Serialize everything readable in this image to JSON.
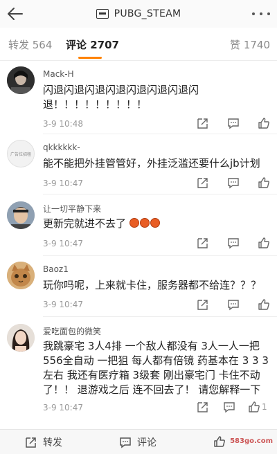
{
  "header": {
    "title": "PUBG_STEAM"
  },
  "tabs": {
    "repost": "转发 564",
    "comment": "评论 2707",
    "like": "赞 1740"
  },
  "comments": [
    {
      "name": "Mack-H",
      "text": "闪退闪退闪退闪退闪退闪退闪退闪退！！！！！！！！！",
      "time": "3-9 10:48"
    },
    {
      "name": "qkkkkkk-",
      "text": "能不能把外挂管管好，外挂泛滥还要什么jb计划",
      "time": "3-9 10:47",
      "avatar_text": "广告位招租"
    },
    {
      "name": "让一切平静下来",
      "text": "更新完就进不去了",
      "time": "3-9 10:47"
    },
    {
      "name": "Baoz1",
      "text": "玩你吗呢，上来就卡住，服务器都不给连？？？",
      "time": "3-9 10:47"
    },
    {
      "name": "爱吃面包的微笑",
      "text": "我跳豪宅 3人4排 一个敌人都没有 3人一人一把556全自动 一把狙 每人都有倍镜 药基本在 3 3 3 左右 我还有医疗箱 3级套 刚出豪宅门 卡住不动了！！ 退游戏之后 连不回去了！ 请您解释一下",
      "time": "3-9 10:47",
      "likes": "1"
    }
  ],
  "bottom": {
    "repost": "转发",
    "comment": "评论",
    "watermark": "583go.com"
  },
  "colors": {
    "accent": "#ff8200"
  }
}
